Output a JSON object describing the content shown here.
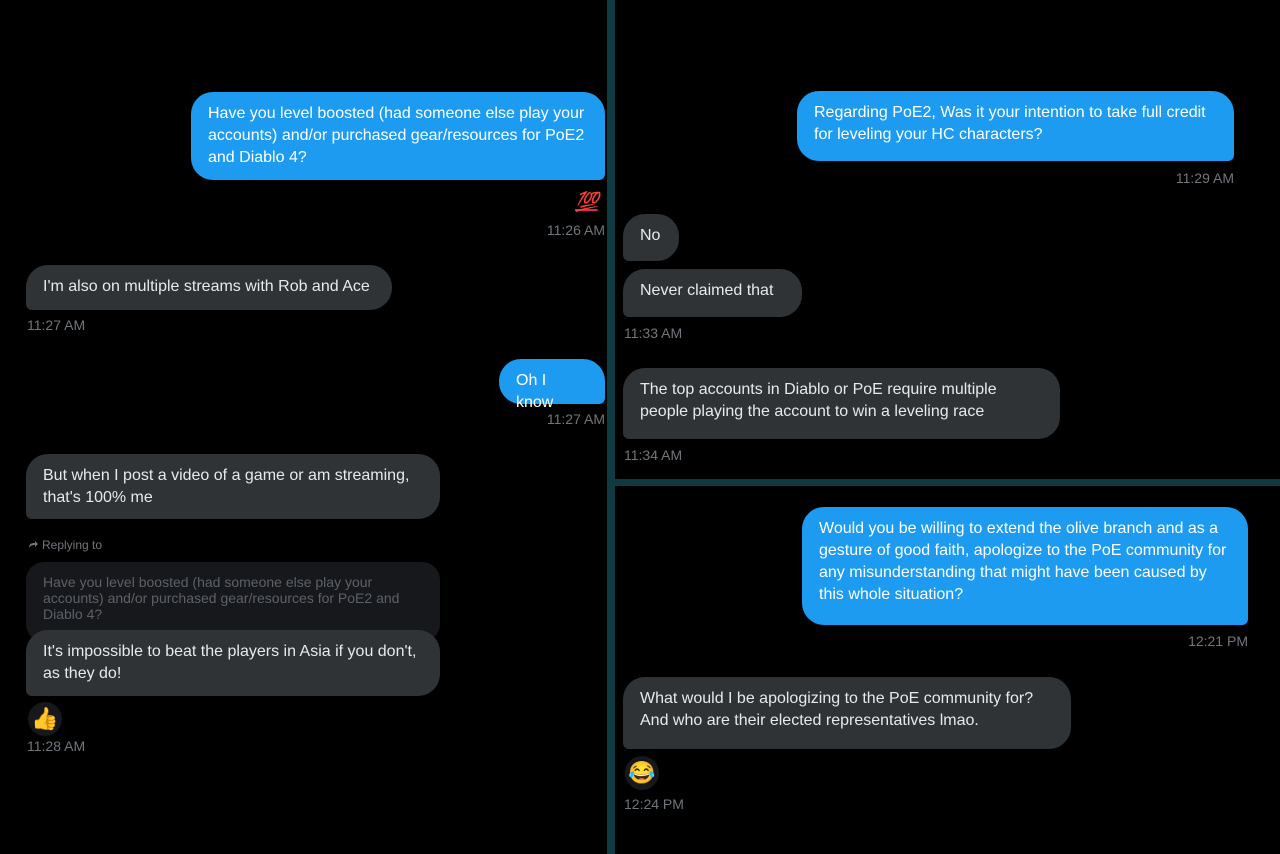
{
  "left_panel": {
    "msg1": "Have you level boosted (had someone else play your accounts) and/or purchased gear/resources for PoE2 and Diablo 4?",
    "reaction1": "💯",
    "ts1": "11:26 AM",
    "msg2": "I'm also on multiple streams with Rob and Ace",
    "ts2": "11:27 AM",
    "msg3": "Oh I know",
    "ts3": "11:27 AM",
    "msg4": "But when I post a video of a game or am streaming, that's 100% me",
    "replying_label": "Replying to",
    "quoted_text": "Have you level boosted (had someone else play your accounts) and/or purchased gear/resources for PoE2 and Diablo 4?",
    "msg5": "It's impossible to beat the players in Asia if you don't, as they do!",
    "reaction2": "👍",
    "ts4": "11:28 AM"
  },
  "top_right_panel": {
    "msg1": "Regarding PoE2, Was it your intention to take full credit for leveling your HC characters?",
    "ts1": "11:29 AM",
    "msg2": "No",
    "msg3": "Never claimed that",
    "ts2": "11:33 AM",
    "msg4": "The top accounts in Diablo or PoE require multiple people playing the account to win a leveling race",
    "ts3": "11:34 AM"
  },
  "bottom_right_panel": {
    "msg1": "Would you be willing to extend the olive branch and as a gesture of good faith, apologize to the PoE community for any misunderstanding that might have been caused by this whole situation?",
    "ts1": "12:21 PM",
    "msg2": "What would I be apologizing to the PoE community for? And who are their elected representatives lmao.",
    "reaction1": "😂",
    "ts2": "12:24 PM"
  },
  "colors": {
    "sent_bubble": "#1d9bf0",
    "received_bubble": "#2f3336",
    "background": "#000000",
    "divider": "#0e3a40",
    "timestamp": "#71767b"
  }
}
